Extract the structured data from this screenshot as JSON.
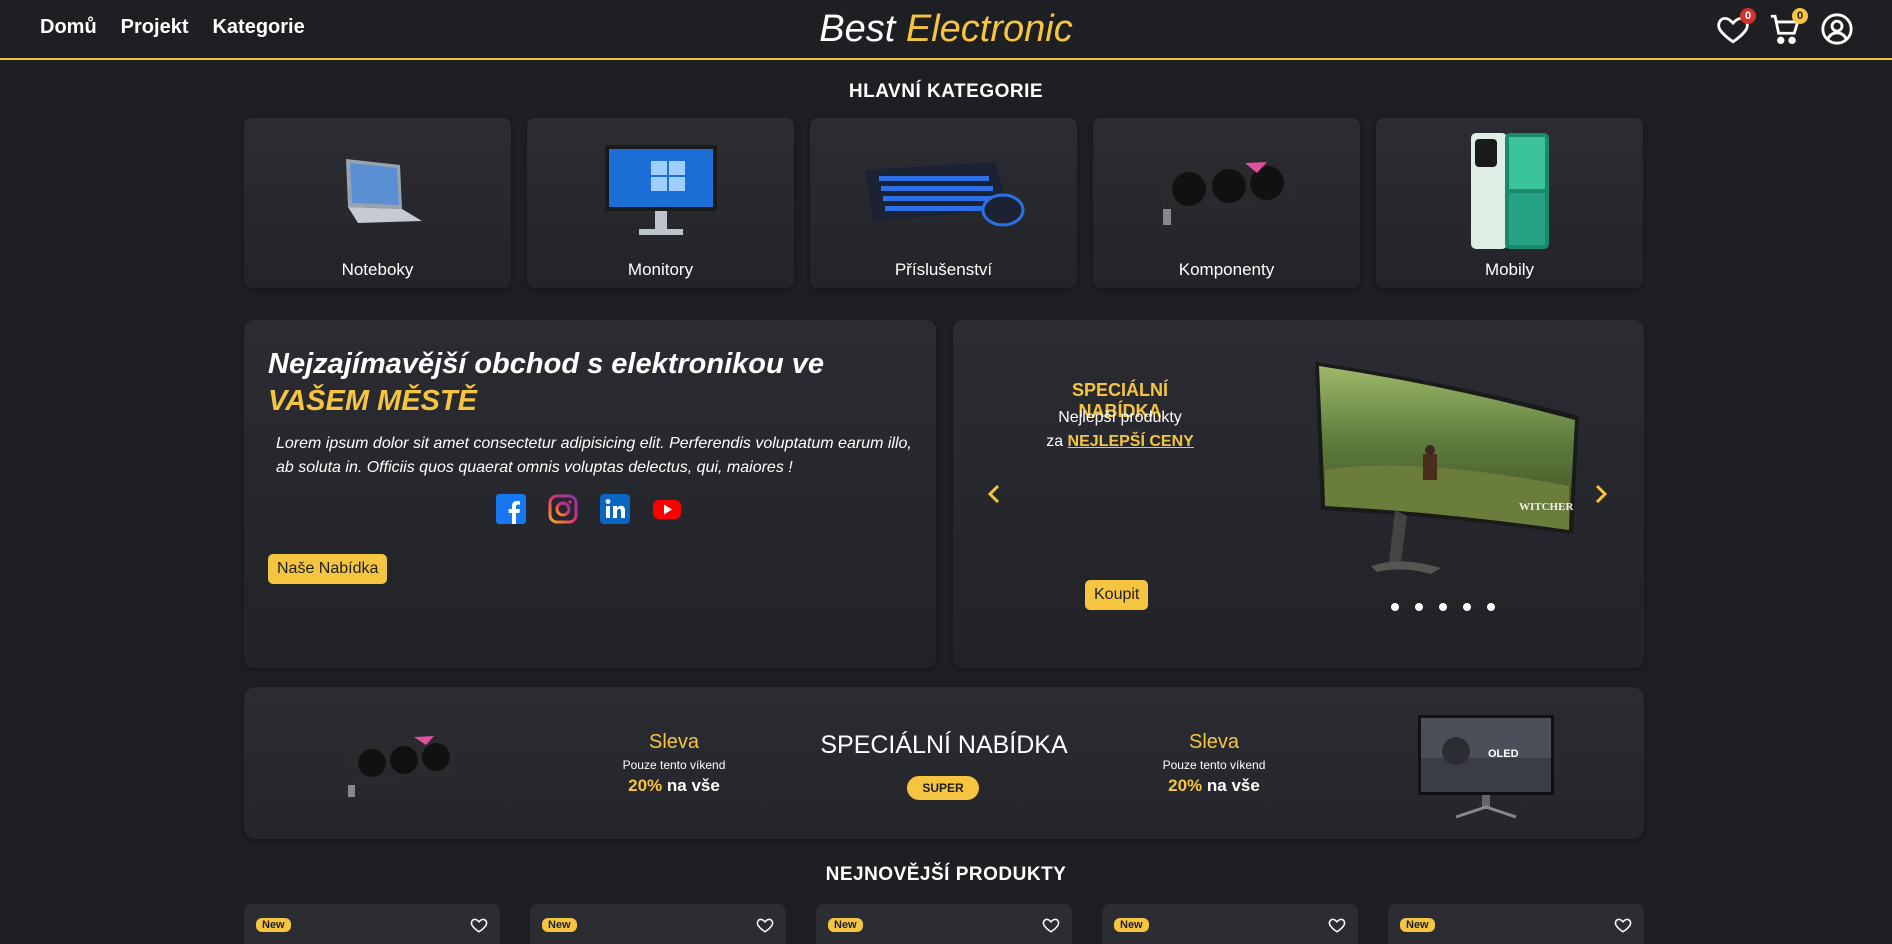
{
  "nav": {
    "links": [
      {
        "label": "Domů"
      },
      {
        "label": "Projekt"
      },
      {
        "label": "Kategorie"
      }
    ],
    "brand_part1": "Best",
    "brand_part2": "Electronic",
    "wishlist_count": "0",
    "cart_count": "0"
  },
  "categories": {
    "title": "HLAVNÍ KATEGORIE",
    "items": [
      {
        "label": "Noteboky",
        "icon": "laptop-image"
      },
      {
        "label": "Monitory",
        "icon": "monitor-image"
      },
      {
        "label": "Příslušenství",
        "icon": "keyboard-mouse-image"
      },
      {
        "label": "Komponenty",
        "icon": "graphics-card-image"
      },
      {
        "label": "Mobily",
        "icon": "smartphone-image"
      }
    ]
  },
  "hero": {
    "title_line1": "Nejzajímavější obchod s elektronikou ve",
    "title_line2": "VAŠEM MĚSTĚ",
    "text": "Lorem ipsum dolor sit amet consectetur adipisicing elit. Perferendis voluptatum earum illo, ab soluta in. Officiis quos quaerat omnis voluptas delectus, qui, maiores !",
    "socials": [
      "facebook-icon",
      "instagram-icon",
      "linkedin-icon",
      "youtube-icon"
    ],
    "button_label": "Naše Nabídka"
  },
  "carousel": {
    "title": "SPECIÁLNÍ NABÍDKA",
    "sub1": "Nejlepší produkty",
    "sub2_prefix": "za",
    "sub2_highlight": "NEJLEPŠÍ CENY",
    "button_label": "Koupit",
    "slide_count": 5
  },
  "promo": {
    "left": {
      "t1": "Sleva",
      "t2": "Pouze tento víkend",
      "pct": "20%",
      "rest": "na vše"
    },
    "center_title": "SPECIÁLNÍ NABÍDKA",
    "badge": "SUPER",
    "right": {
      "t1": "Sleva",
      "t2": "Pouze tento víkend",
      "pct": "20%",
      "rest": "na vše"
    }
  },
  "products": {
    "title": "NEJNOVĚJŠÍ PRODUKTY",
    "new_label": "New",
    "count": 5
  },
  "colors": {
    "accent": "#f5c542",
    "background": "#1e1f23",
    "card": "#2b2d33"
  }
}
